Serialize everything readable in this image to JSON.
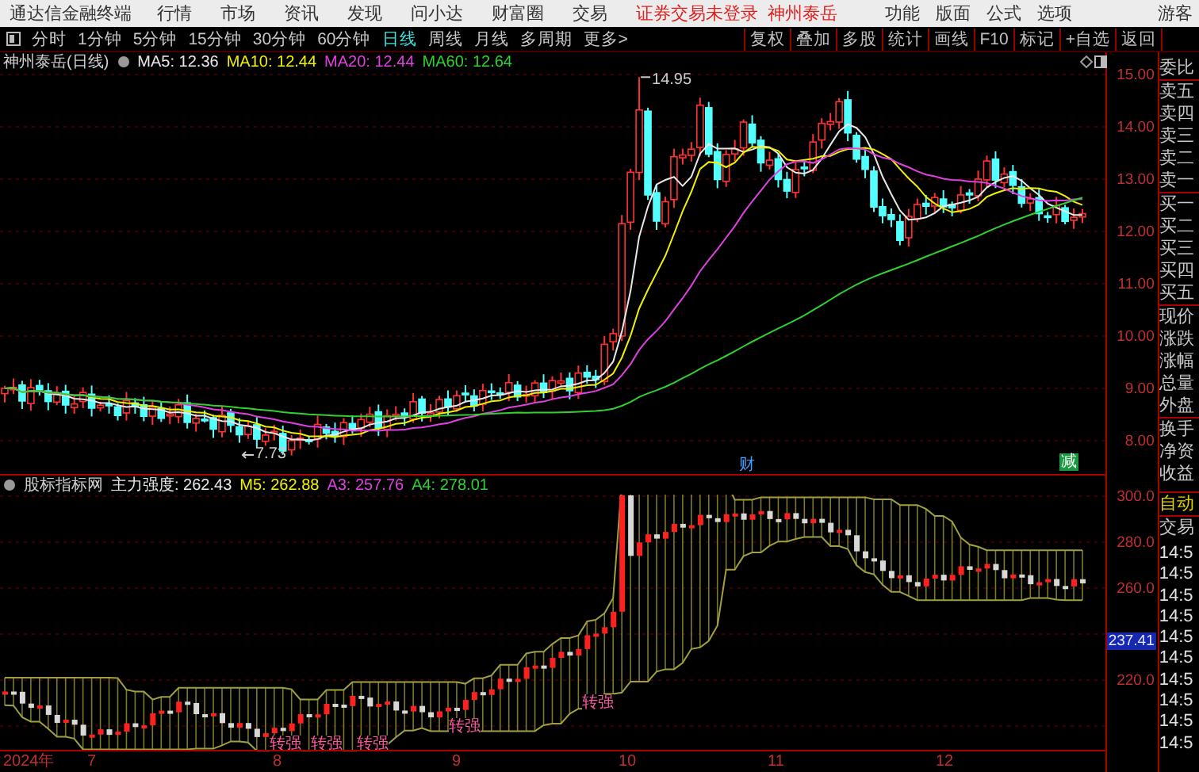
{
  "app_title": "通达信金融终端",
  "menu": [
    "行情",
    "市场",
    "资讯",
    "发现",
    "问小达",
    "财富圈",
    "交易"
  ],
  "login_status": "证券交易未登录",
  "account_stock": "神州泰岳",
  "right_menu": [
    "功能",
    "版面",
    "公式",
    "选项"
  ],
  "user": "游客",
  "periods": [
    {
      "label": "分时",
      "selected": false
    },
    {
      "label": "1分钟",
      "selected": false
    },
    {
      "label": "5分钟",
      "selected": false
    },
    {
      "label": "15分钟",
      "selected": false
    },
    {
      "label": "30分钟",
      "selected": false
    },
    {
      "label": "60分钟",
      "selected": false
    },
    {
      "label": "日线",
      "selected": true
    },
    {
      "label": "周线",
      "selected": false
    },
    {
      "label": "月线",
      "selected": false
    },
    {
      "label": "多周期",
      "selected": false
    },
    {
      "label": "更多>",
      "selected": false
    }
  ],
  "chart_tools": [
    "复权",
    "叠加",
    "多股",
    "统计",
    "画线",
    "F10",
    "标记",
    "+自选",
    "返回"
  ],
  "main_legend": {
    "title": "神州泰岳(日线)",
    "items": [
      {
        "label": "MA5: 12.36",
        "color": "#e8e8e8"
      },
      {
        "label": "MA10: 12.44",
        "color": "#f0f000"
      },
      {
        "label": "MA20: 12.44",
        "color": "#e040e0"
      },
      {
        "label": "MA60: 12.64",
        "color": "#30d030"
      }
    ]
  },
  "high_label": "14.95",
  "low_label": "7.73",
  "events": [
    {
      "label": "财",
      "kind": "text"
    },
    {
      "label": "减",
      "kind": "badge"
    }
  ],
  "price_axis": [
    "15.00",
    "14.00",
    "13.00",
    "12.00",
    "11.00",
    "10.00",
    "9.00",
    "8.00"
  ],
  "indicator_legend": {
    "title": "股标指标网",
    "items": [
      {
        "label": "主力强度: 262.43",
        "color": "#e8e8e8"
      },
      {
        "label": "M5: 262.88",
        "color": "#f0f000"
      },
      {
        "label": "A3: 257.76",
        "color": "#e040e0"
      },
      {
        "label": "A4: 278.01",
        "color": "#30d030"
      }
    ]
  },
  "signals": [
    "转强",
    "转强",
    "转强",
    "转强",
    "转强"
  ],
  "indicator_axis": [
    {
      "label": "300.0",
      "current": false
    },
    {
      "label": "280.0",
      "current": false
    },
    {
      "label": "260.0",
      "current": false
    },
    {
      "label": "237.41",
      "current": true
    },
    {
      "label": "220.0",
      "current": false
    }
  ],
  "date_axis": [
    "2024年",
    "7",
    "8",
    "9",
    "10",
    "11",
    "12"
  ],
  "quote_panel": [
    {
      "label": "委比",
      "kind": "field"
    },
    {
      "label": "卖五",
      "kind": "field"
    },
    {
      "label": "卖四",
      "kind": "field"
    },
    {
      "label": "卖三",
      "kind": "field"
    },
    {
      "label": "卖二",
      "kind": "field"
    },
    {
      "label": "卖一",
      "kind": "field"
    },
    {
      "label": "买一",
      "kind": "field"
    },
    {
      "label": "买二",
      "kind": "field"
    },
    {
      "label": "买三",
      "kind": "field"
    },
    {
      "label": "买四",
      "kind": "field"
    },
    {
      "label": "买五",
      "kind": "field"
    },
    {
      "label": "现价",
      "kind": "field"
    },
    {
      "label": "涨跌",
      "kind": "field"
    },
    {
      "label": "涨幅",
      "kind": "field"
    },
    {
      "label": "总量",
      "kind": "field"
    },
    {
      "label": "外盘",
      "kind": "field"
    },
    {
      "label": "换手",
      "kind": "field"
    },
    {
      "label": "净资",
      "kind": "field"
    },
    {
      "label": "收益",
      "kind": "field"
    },
    {
      "label": "自动",
      "kind": "mode"
    },
    {
      "label": "交易",
      "kind": "field"
    }
  ],
  "ticks": [
    "14:5",
    "14:5",
    "14:5",
    "14:5",
    "14:5",
    "14:5",
    "14:5",
    "14:5",
    "14:5",
    "14:5"
  ]
}
